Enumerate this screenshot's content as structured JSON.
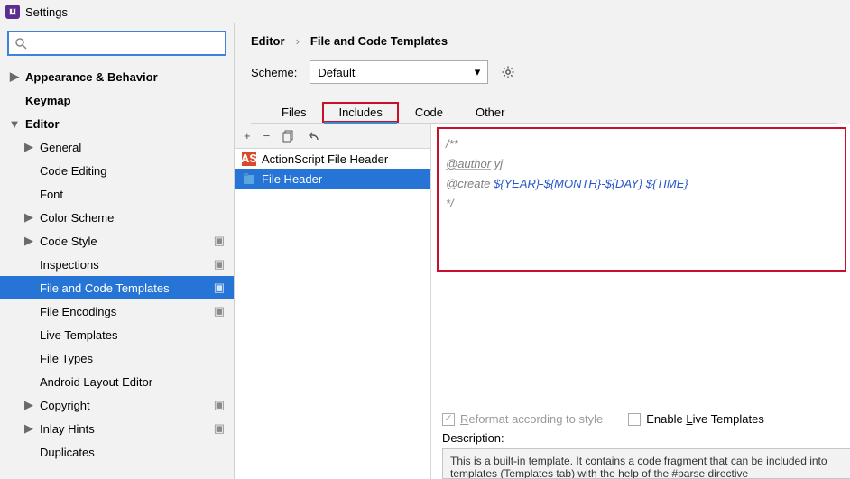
{
  "window": {
    "title": "Settings"
  },
  "search": {
    "placeholder": ""
  },
  "sidebar": {
    "items": [
      {
        "label": "Appearance & Behavior",
        "level": "top",
        "arrow": "right"
      },
      {
        "label": "Keymap",
        "level": "top",
        "arrow": "none"
      },
      {
        "label": "Editor",
        "level": "top",
        "arrow": "down"
      },
      {
        "label": "General",
        "level": "sub",
        "arrow": "right"
      },
      {
        "label": "Code Editing",
        "level": "sub",
        "arrow": "none"
      },
      {
        "label": "Font",
        "level": "sub",
        "arrow": "none"
      },
      {
        "label": "Color Scheme",
        "level": "sub",
        "arrow": "right"
      },
      {
        "label": "Code Style",
        "level": "sub",
        "arrow": "right",
        "trailing": true
      },
      {
        "label": "Inspections",
        "level": "sub",
        "arrow": "none",
        "trailing": true
      },
      {
        "label": "File and Code Templates",
        "level": "sub",
        "arrow": "none",
        "trailing": true,
        "selected": true
      },
      {
        "label": "File Encodings",
        "level": "sub",
        "arrow": "none",
        "trailing": true
      },
      {
        "label": "Live Templates",
        "level": "sub",
        "arrow": "none"
      },
      {
        "label": "File Types",
        "level": "sub",
        "arrow": "none"
      },
      {
        "label": "Android Layout Editor",
        "level": "sub",
        "arrow": "none"
      },
      {
        "label": "Copyright",
        "level": "sub",
        "arrow": "right",
        "trailing": true
      },
      {
        "label": "Inlay Hints",
        "level": "sub",
        "arrow": "right",
        "trailing": true
      },
      {
        "label": "Duplicates",
        "level": "sub",
        "arrow": "none"
      }
    ]
  },
  "breadcrumb": {
    "a": "Editor",
    "b": "File and Code Templates"
  },
  "scheme": {
    "label": "Scheme:",
    "value": "Default"
  },
  "subtabs": {
    "items": [
      "Files",
      "Includes",
      "Code",
      "Other"
    ],
    "active": 1
  },
  "tpl_toolbar": {
    "add": "+",
    "remove": "−"
  },
  "templates": [
    {
      "label": "ActionScript File Header",
      "icon": "as"
    },
    {
      "label": "File Header",
      "icon": "file",
      "selected": true
    }
  ],
  "code": {
    "l1": "/**",
    "author_tag": "@author",
    "author_val": " yj",
    "create_tag": "@create",
    "create_val": " ${YEAR}-${MONTH}-${DAY} ${TIME}",
    "l4": "*/"
  },
  "options": {
    "reformat_pre": "R",
    "reformat_rest": "eformat according to style",
    "live_pre": "Enable ",
    "live_u": "L",
    "live_rest": "ive Templates",
    "reformat_checked": true,
    "live_checked": false
  },
  "description": {
    "label": "Description:",
    "text": "This is a built-in template. It contains a code fragment that can be included into templates (Templates tab) with the help of the #parse directive"
  }
}
